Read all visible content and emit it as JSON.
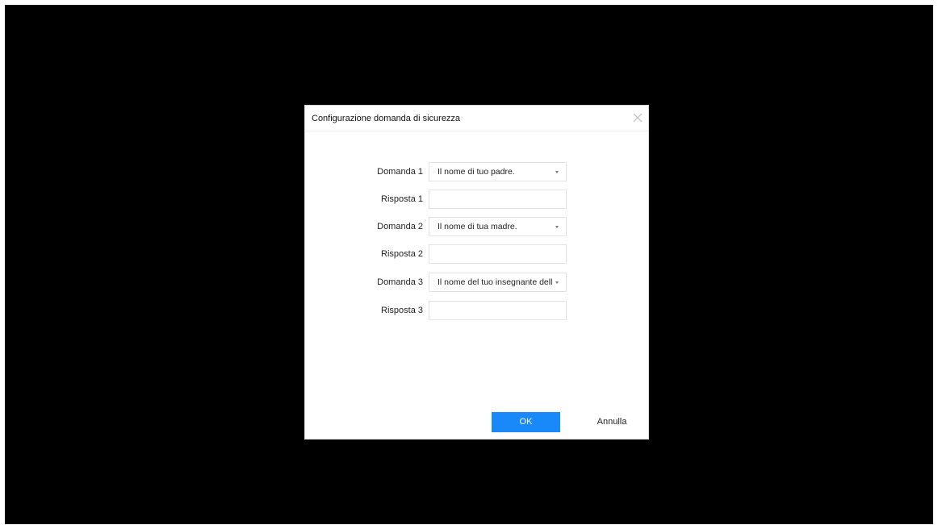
{
  "dialog": {
    "title": "Configurazione domanda di sicurezza",
    "close_icon": "close-icon"
  },
  "form": {
    "rows": [
      {
        "label": "Domanda 1",
        "type": "select",
        "value": "Il nome di tuo padre."
      },
      {
        "label": "Risposta 1",
        "type": "input",
        "value": ""
      },
      {
        "label": "Domanda 2",
        "type": "select",
        "value": "Il nome di tua madre."
      },
      {
        "label": "Risposta 2",
        "type": "input",
        "value": ""
      },
      {
        "label": "Domanda 3",
        "type": "select",
        "value": "Il nome del tuo insegnante delle elementari."
      },
      {
        "label": "Risposta 3",
        "type": "input",
        "value": ""
      }
    ]
  },
  "buttons": {
    "ok_label": "OK",
    "cancel_label": "Annulla"
  },
  "colors": {
    "backdrop": "#000000",
    "dialog_background": "#ffffff",
    "primary": "#1989fa"
  }
}
